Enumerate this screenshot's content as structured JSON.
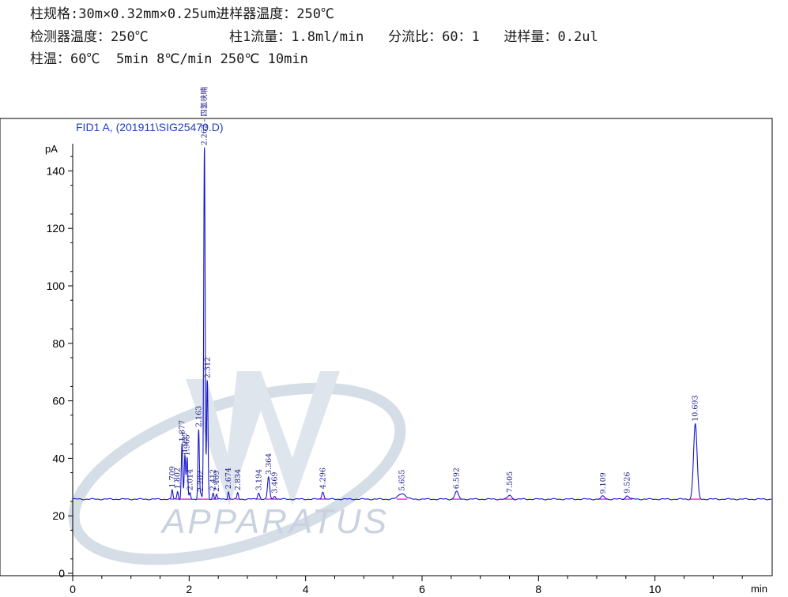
{
  "header": {
    "line1": "柱规格:30m×0.32mm×0.25um进样器温度：250℃",
    "line2": "检测器温度：250℃          柱1流量：1.8ml/min   分流比：60：1   进样量：0.2ul",
    "line3": "柱温：60℃  5min 8℃/min 250℃ 10min"
  },
  "watermark": {
    "text": "APPARATUS",
    "color": "#c9d3df"
  },
  "colors": {
    "signal": "#1515d0",
    "baseline": "#e020e0",
    "frame": "#000000"
  },
  "chart_data": {
    "type": "line",
    "title": "FID1 A, (201911\\SIG25470.D)",
    "xlabel": "min",
    "ylabel": "pA",
    "xlim": [
      0,
      12
    ],
    "ylim": [
      0,
      150
    ],
    "x_ticks": [
      0,
      2,
      4,
      6,
      8,
      10
    ],
    "y_ticks": [
      0,
      20,
      40,
      60,
      80,
      100,
      120,
      140
    ],
    "baseline": 25.8,
    "grid": false,
    "series": [
      {
        "values": "chromatogram trace",
        "peaks": [
          {
            "rt": 1.709,
            "label": "1.709",
            "height": 29.0
          },
          {
            "rt": 1.802,
            "label": "1.802",
            "height": 28.5
          },
          {
            "rt": 1.877,
            "label": "1.877",
            "height": 45.0
          },
          {
            "rt": 1.927,
            "label": "1.927",
            "height": 41.0
          },
          {
            "rt": 1.965,
            "label": "1.965",
            "height": 40.0
          },
          {
            "rt": 2.014,
            "label": "2.014",
            "height": 28.0
          },
          {
            "rt": 2.163,
            "label": "2.163",
            "height": 50.0
          },
          {
            "rt": 2.202,
            "label": "2.202",
            "height": 27.5
          },
          {
            "rt": 2.262,
            "label": "2.262 - 四氢呋喃",
            "height": 148.0
          },
          {
            "rt": 2.312,
            "label": "2.312",
            "height": 67.0
          },
          {
            "rt": 2.412,
            "label": "2.412",
            "height": 28.0
          },
          {
            "rt": 2.469,
            "label": "2.469",
            "height": 27.5
          },
          {
            "rt": 2.674,
            "label": "2.674",
            "height": 28.5
          },
          {
            "rt": 2.834,
            "label": "2.834",
            "height": 28.0
          },
          {
            "rt": 3.194,
            "label": "3.194",
            "height": 28.0
          },
          {
            "rt": 3.364,
            "label": "3.364",
            "height": 33.5
          },
          {
            "rt": 3.469,
            "label": "3.469",
            "height": 27.0
          },
          {
            "rt": 4.296,
            "label": "4.296",
            "height": 28.5
          },
          {
            "rt": 5.655,
            "label": "5.655",
            "height": 27.8
          },
          {
            "rt": 6.592,
            "label": "6.592",
            "height": 28.5
          },
          {
            "rt": 7.505,
            "label": "7.505",
            "height": 27.2
          },
          {
            "rt": 9.109,
            "label": "9.109",
            "height": 26.8
          },
          {
            "rt": 9.526,
            "label": "9.526",
            "height": 27.0
          },
          {
            "rt": 10.693,
            "label": "10.693",
            "height": 52.0
          }
        ]
      }
    ]
  }
}
